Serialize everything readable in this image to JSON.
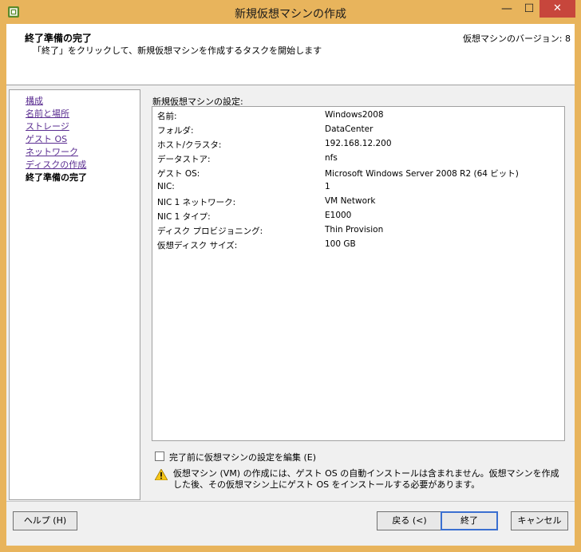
{
  "window": {
    "title": "新規仮想マシンの作成",
    "minimize": "—",
    "maximize": "☐",
    "close": "✕"
  },
  "header": {
    "title": "終了準備の完了",
    "subtitle": "「終了」をクリックして、新規仮想マシンを作成するタスクを開始します",
    "version": "仮想マシンのバージョン: 8"
  },
  "nav": {
    "items": [
      {
        "label": "構成"
      },
      {
        "label": "名前と場所"
      },
      {
        "label": "ストレージ"
      },
      {
        "label": "ゲスト OS"
      },
      {
        "label": "ネットワーク"
      },
      {
        "label": "ディスクの作成"
      },
      {
        "label": "終了準備の完了"
      }
    ]
  },
  "settings": {
    "label": "新規仮想マシンの設定:",
    "rows": [
      {
        "key": "名前:",
        "value": "Windows2008"
      },
      {
        "key": "フォルダ:",
        "value": "DataCenter"
      },
      {
        "key": "ホスト/クラスタ:",
        "value": "192.168.12.200"
      },
      {
        "key": "データストア:",
        "value": "nfs"
      },
      {
        "key": "ゲスト OS:",
        "value": "Microsoft Windows Server 2008 R2 (64 ビット)"
      },
      {
        "key": "NIC:",
        "value": "1"
      },
      {
        "key": "NIC 1 ネットワーク:",
        "value": "VM Network"
      },
      {
        "key": "NIC 1 タイプ:",
        "value": "E1000"
      },
      {
        "key": "ディスク プロビジョニング:",
        "value": "Thin Provision"
      },
      {
        "key": "仮想ディスク サイズ:",
        "value": "100 GB"
      }
    ]
  },
  "edit_checkbox": {
    "label": "完了前に仮想マシンの設定を編集 (E)",
    "checked": false
  },
  "warning": {
    "text": "仮想マシン (VM) の作成には、ゲスト OS の自動インストールは含まれません。仮想マシンを作成した後、その仮想マシン上にゲスト OS をインストールする必要があります。"
  },
  "buttons": {
    "help": "ヘルプ (H)",
    "back": "戻る (<)",
    "finish": "終了",
    "cancel": "キャンセル"
  },
  "colors": {
    "titlebar": "#e8b45c",
    "close": "#c7463c",
    "link": "#5a2d91"
  }
}
